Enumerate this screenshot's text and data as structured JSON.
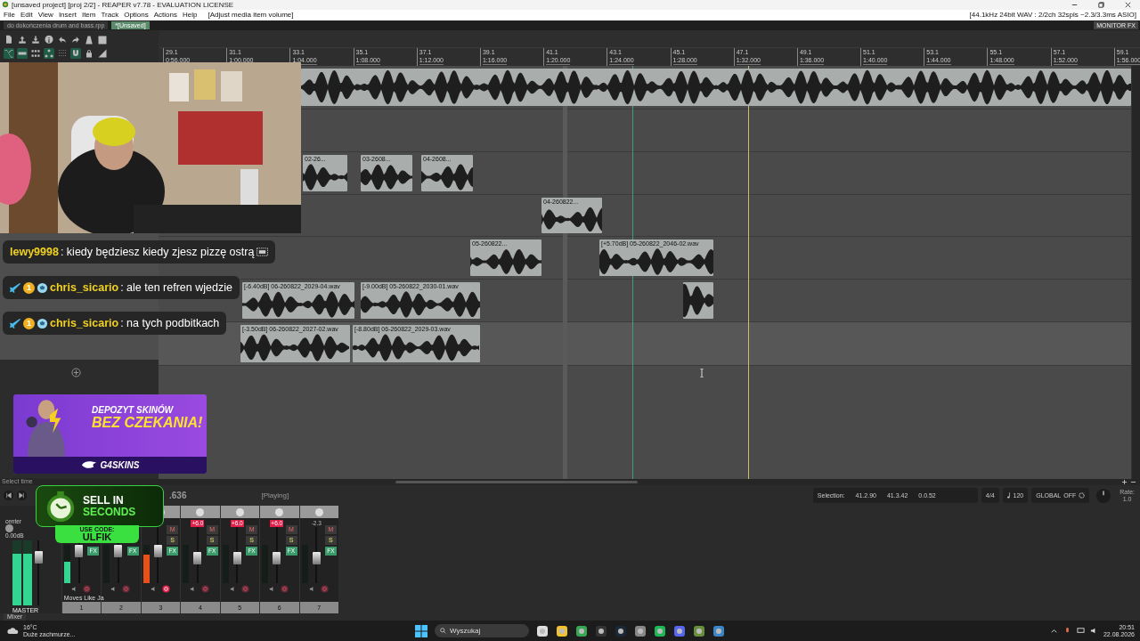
{
  "window": {
    "title": "[unsaved project] [proj 2/2] - REAPER v7.78 - EVALUATION LICENSE"
  },
  "menu": [
    "File",
    "Edit",
    "View",
    "Insert",
    "Item",
    "Track",
    "Options",
    "Actions",
    "Help"
  ],
  "menu_hint": "[Adjust media item volume]",
  "audio_status": "[44.1kHz 24bit WAV : 2/2ch 32spls ~2.3/3.3ms ASIO]",
  "project_tabs": [
    {
      "label": "do dokończenia drum and bass.rpp",
      "selected": false
    },
    {
      "label": "*[Unsaved]",
      "selected": true
    }
  ],
  "monitor_fx": "MONITOR FX",
  "toolbar_toggles": [
    {
      "on": true
    },
    {
      "on": true
    },
    {
      "on": false
    },
    {
      "on": true
    },
    {
      "on": false
    },
    {
      "on": true
    },
    {
      "on": false
    },
    {
      "on": false
    }
  ],
  "ruler": [
    {
      "bar": "29.1",
      "time": "0:56.000"
    },
    {
      "bar": "31.1",
      "time": "1:00.000"
    },
    {
      "bar": "33.1",
      "time": "1:04.000"
    },
    {
      "bar": "35.1",
      "time": "1:08.000"
    },
    {
      "bar": "37.1",
      "time": "1:12.000"
    },
    {
      "bar": "39.1",
      "time": "1:16.000"
    },
    {
      "bar": "41.1",
      "time": "1:20.000"
    },
    {
      "bar": "43.1",
      "time": "1:24.000"
    },
    {
      "bar": "45.1",
      "time": "1:28.000"
    },
    {
      "bar": "47.1",
      "time": "1:32.000"
    },
    {
      "bar": "49.1",
      "time": "1:36.000"
    },
    {
      "bar": "51.1",
      "time": "1:40.000"
    },
    {
      "bar": "53.1",
      "time": "1:44.000"
    },
    {
      "bar": "55.1",
      "time": "1:48.000"
    },
    {
      "bar": "57.1",
      "time": "1:52.000"
    },
    {
      "bar": "59.1",
      "time": "1:56.000"
    }
  ],
  "tracks": [
    {
      "selected": false,
      "items": [
        {
          "kind": "audio"
        }
      ]
    },
    {
      "selected": false
    },
    {
      "selected": false,
      "items": [
        {
          "kind": "audio",
          "label": "02-26..."
        },
        {
          "kind": "audio",
          "label": "03-2608..."
        },
        {
          "kind": "audio",
          "label": "04-2608..."
        }
      ]
    },
    {
      "selected": false,
      "items": [
        {
          "kind": "audio",
          "label": "04-260822..."
        }
      ]
    },
    {
      "selected": false,
      "items": [
        {
          "kind": "audio",
          "label": "05-260822..."
        },
        {
          "kind": "audio",
          "label": "[+5.70dB] 05-260822_2046-02.wav"
        }
      ]
    },
    {
      "selected": false,
      "items": [
        {
          "kind": "audio",
          "label": "[-6.40dB] 06-260822_2029-04.wav"
        },
        {
          "kind": "audio",
          "label": "[-9.00dB] 05-260822_2030-01.wav"
        },
        {
          "kind": "audio"
        }
      ]
    },
    {
      "selected": true,
      "items": [
        {
          "kind": "audio",
          "label": "[-3.50dB] 06-260822_2027-02.wav"
        },
        {
          "kind": "audio",
          "label": "[-8.80dB] 06-260822_2029-03.wav"
        }
      ]
    }
  ],
  "chat": [
    {
      "user": "lewy9998",
      "text": ": kiedy będziesz kiedy zjesz pizzę ostrą",
      "object_mark": true
    },
    {
      "user": "chris_sicario",
      "text": ": ale ten refren wjedzie",
      "badges": [
        {
          "kind": "sword"
        },
        {
          "kind": "tier",
          "text": "1"
        },
        {
          "kind": "globe"
        }
      ]
    },
    {
      "user": "chris_sicario",
      "text": ": na tych podbitkach",
      "badges": [
        {
          "kind": "sword"
        },
        {
          "kind": "tier",
          "text": "1"
        },
        {
          "kind": "globe"
        }
      ]
    }
  ],
  "ad_banner": {
    "line_1": "DEPOZYT SKINÓW",
    "line_2": "BEZ CZEKANIA!",
    "brand": "G4SKINS"
  },
  "sell_ad": {
    "line_1": "SELL IN",
    "line_2": "SECONDS",
    "code_label": "USE CODE:",
    "code": "ULFIK"
  },
  "transport": {
    "hint": "Select time",
    "time": ".636",
    "state": "[Playing]"
  },
  "selection": {
    "label": "Selection:",
    "start": "41.2.90",
    "end": "41.3.42",
    "length": "0.0.52",
    "time_signature": "4/4",
    "tempo": "120",
    "global_label": "GLOBAL",
    "global_state": "OFF",
    "rate_label": "Rate:",
    "rate": "1.0"
  },
  "master": {
    "pan": "center",
    "volume": "0.00dB",
    "name": "MASTER",
    "level": 0.8
  },
  "channels": [
    {
      "number": "1",
      "name": "Moves Like Ja",
      "level": 0.55,
      "clipped": false,
      "armed": false,
      "buttons": [
        {
          "kind": "fx",
          "text": "FX"
        }
      ]
    },
    {
      "number": "2",
      "armed": false,
      "buttons": [
        {
          "kind": "fx",
          "text": "FX"
        }
      ]
    },
    {
      "number": "3",
      "level": 0.75,
      "clipped": true,
      "armed": true,
      "buttons": [
        {
          "kind": "mute",
          "text": "M"
        },
        {
          "kind": "solo",
          "text": "S"
        },
        {
          "kind": "fx",
          "text": "FX"
        }
      ]
    },
    {
      "number": "4",
      "peak": "+6.0",
      "clipped": true,
      "armed": false,
      "buttons": [
        {
          "kind": "mute",
          "text": "M"
        },
        {
          "kind": "solo",
          "text": "S"
        },
        {
          "kind": "fx",
          "text": "FX"
        }
      ]
    },
    {
      "number": "5",
      "peak": "+6.0",
      "clipped": true,
      "armed": false,
      "buttons": [
        {
          "kind": "mute",
          "text": "M"
        },
        {
          "kind": "solo",
          "text": "S"
        },
        {
          "kind": "fx",
          "text": "FX"
        }
      ]
    },
    {
      "number": "6",
      "peak": "+6.0",
      "clipped": true,
      "armed": false,
      "buttons": [
        {
          "kind": "mute",
          "text": "M"
        },
        {
          "kind": "solo",
          "text": "S"
        },
        {
          "kind": "fx",
          "text": "FX"
        }
      ]
    },
    {
      "number": "7",
      "peak": "-2.3",
      "clipped": false,
      "armed": false,
      "buttons": [
        {
          "kind": "mute",
          "text": "M"
        },
        {
          "kind": "solo",
          "text": "S"
        },
        {
          "kind": "fx",
          "text": "FX"
        }
      ]
    }
  ],
  "mixer_tab": "Mixer",
  "taskbar": {
    "weather_temp": "16°C",
    "weather_text": "Duże zachmurze...",
    "search": {
      "placeholder": "Wyszukaj"
    },
    "time": "20:51",
    "date": "22.08.2026"
  }
}
